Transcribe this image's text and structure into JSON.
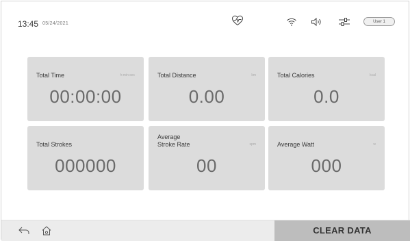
{
  "status_bar": {
    "time": "13:45",
    "date": "05/24/2021",
    "user_label": "User 1",
    "icons": [
      "heart-rate-icon",
      "wifi-icon",
      "volume-icon",
      "settings-sliders-icon"
    ]
  },
  "tiles": [
    {
      "label": "Total Time",
      "unit": "h:min:sec",
      "value": "00:00:00"
    },
    {
      "label": "Total Distance",
      "unit": "km",
      "value": "0.00"
    },
    {
      "label": "Total Calories",
      "unit": "kcal",
      "value": "0.0"
    },
    {
      "label": "Total Strokes",
      "unit": "",
      "value": "000000"
    },
    {
      "label_line1": "Average",
      "label_line2": "Stroke Rate",
      "unit": "spm",
      "value": "00"
    },
    {
      "label": "Average Watt",
      "unit": "w",
      "value": "000"
    }
  ],
  "bottom_bar": {
    "icons": [
      "back-arrow-icon",
      "home-icon"
    ],
    "clear_label": "CLEAR DATA"
  },
  "colors": {
    "tile_bg": "#dcdcdc",
    "value_text": "#6a6a6a",
    "clear_button_bg": "#bdbdbd"
  }
}
